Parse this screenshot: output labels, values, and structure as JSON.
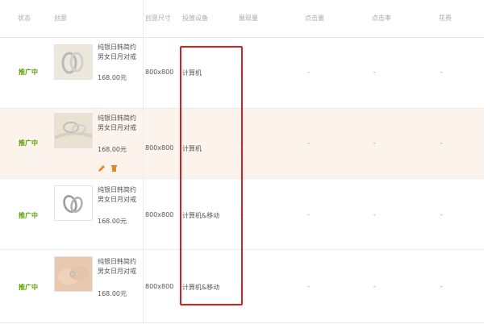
{
  "header": {
    "status": "状态",
    "creative": "创意",
    "size": "创意尺寸",
    "device": "投放设备",
    "impressions": "展现量",
    "clicks": "点击量",
    "ctr": "点击率",
    "cost": "花费"
  },
  "rows": [
    {
      "status": "推广中",
      "title": "纯银日韩简约男女日月对戒",
      "price": "168.00元",
      "size": "800x800",
      "device": "计算机",
      "impressions": "-",
      "clicks": "-",
      "ctr": "-",
      "cost": "-",
      "thumb": "ring-photo-beige"
    },
    {
      "status": "推广中",
      "title": "纯银日韩简约男女日月对戒",
      "price": "168.00元",
      "size": "800x800",
      "device": "计算机",
      "impressions": "-",
      "clicks": "-",
      "ctr": "-",
      "cost": "-",
      "thumb": "ring-photo-fabric",
      "actions": [
        "edit-icon",
        "delete-icon"
      ]
    },
    {
      "status": "推广中",
      "title": "纯银日韩简约男女日月对戒",
      "price": "168.00元",
      "size": "800x800",
      "device": "计算机&移动",
      "impressions": "-",
      "clicks": "-",
      "ctr": "-",
      "cost": "-",
      "thumb": "ring-photo-white"
    },
    {
      "status": "推广中",
      "title": "纯银日韩简约男女日月对戒",
      "price": "168.00元",
      "size": "800x800",
      "device": "计算机&移动",
      "impressions": "-",
      "clicks": "-",
      "ctr": "-",
      "cost": "-",
      "thumb": "ring-photo-hands"
    }
  ],
  "colors": {
    "status_green": "#58a000",
    "highlight_row": "#fbf3ec",
    "annotation_red": "#d32020",
    "action_orange": "#e8832a"
  }
}
